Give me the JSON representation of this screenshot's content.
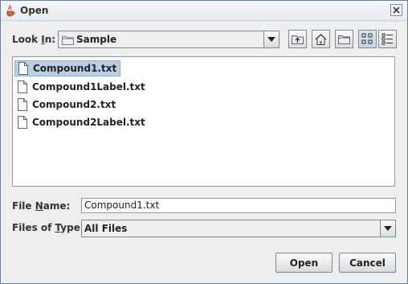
{
  "window": {
    "title": "Open",
    "app_icon": "java-coffee-icon",
    "close_icon": "close-icon"
  },
  "look_in": {
    "label_pre": "Look ",
    "label_mnemonic": "I",
    "label_post": "n:",
    "value": "Sample",
    "folder_icon": "folder-icon"
  },
  "toolbar": {
    "buttons": [
      {
        "name": "up-one-level-icon"
      },
      {
        "name": "home-icon"
      },
      {
        "name": "new-folder-icon"
      },
      {
        "name": "list-view-icon",
        "pressed": true
      },
      {
        "name": "details-view-icon"
      }
    ]
  },
  "files": {
    "items": [
      {
        "name": "Compound1.txt",
        "selected": true
      },
      {
        "name": "Compound1Label.txt",
        "selected": false
      },
      {
        "name": "Compound2.txt",
        "selected": false
      },
      {
        "name": "Compound2Label.txt",
        "selected": false
      }
    ]
  },
  "file_name": {
    "label_pre": "File ",
    "label_mnemonic": "N",
    "label_post": "ame:",
    "value": "Compound1.txt"
  },
  "file_type": {
    "label_pre": "Files of ",
    "label_mnemonic": "T",
    "label_post": "ype:",
    "value": "All Files"
  },
  "buttons": {
    "open": "Open",
    "cancel": "Cancel"
  }
}
